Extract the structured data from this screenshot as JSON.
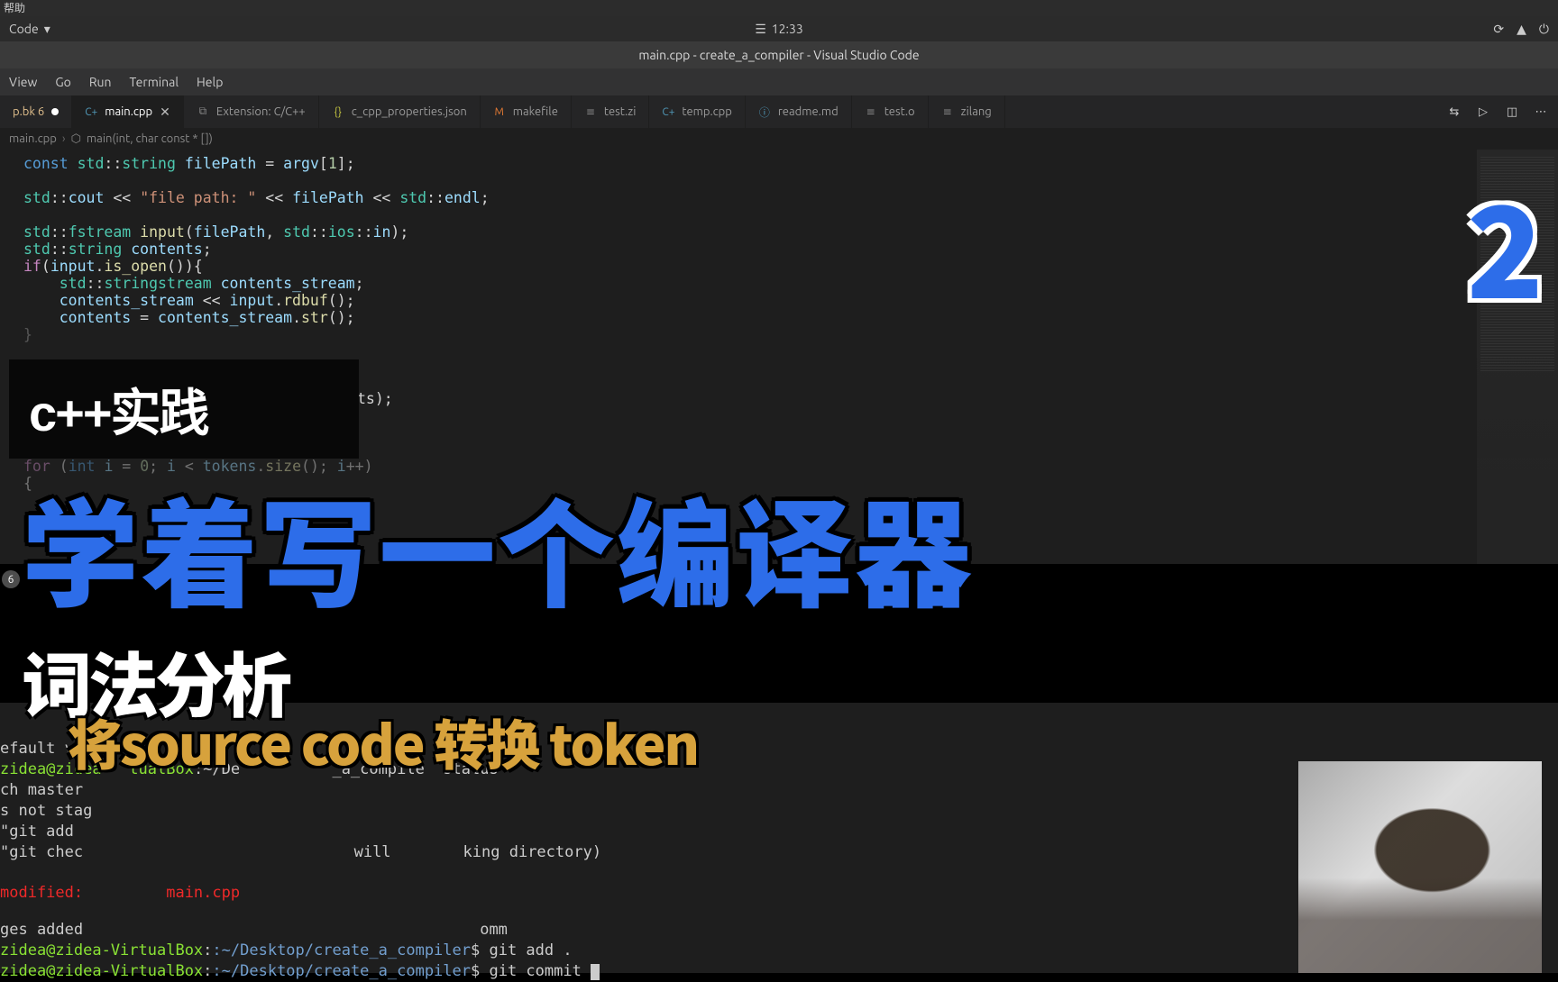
{
  "window_title_strip": "帮助",
  "appbar": {
    "left_label": "Code",
    "clock": "12:33"
  },
  "title_bar": "main.cpp - create_a_compiler - Visual Studio Code",
  "menubar": [
    "View",
    "Go",
    "Run",
    "Terminal",
    "Help"
  ],
  "tabs": {
    "t0": {
      "label": "p.bk 6"
    },
    "t1": {
      "label": "main.cpp"
    },
    "t2": {
      "label": "Extension: C/C++"
    },
    "t3": {
      "label": "c_cpp_properties.json"
    },
    "t4": {
      "label": "makefile"
    },
    "t5": {
      "label": "test.zi"
    },
    "t6": {
      "label": "temp.cpp"
    },
    "t7": {
      "label": "readme.md"
    },
    "t8": {
      "label": "test.o"
    },
    "t9": {
      "label": "zilang"
    }
  },
  "breadcrumbs": {
    "level0": "main.cpp",
    "level1": "main(int, char const * [])"
  },
  "code": {
    "partial": "ts);",
    "loop": "for (int i = 0; i < tokens.size(); i++)"
  },
  "problems_badge": "6",
  "terminal": {
    "l0": "efault valu",
    "l1_host": "zidea@zidea-  tualBox",
    "l1_path": ":~/De          _a_compile",
    "l1_cmd": "  status",
    "l2": "ch master",
    "l3": "s not stag",
    "l4": "\"git add",
    "l5a": "\"git chec",
    "l5b": "  will",
    "l5c": "king directory)",
    "l6": "modified:         main.cpp",
    "l7": "ges added                                           omm",
    "p2_host": "zidea@zidea-VirtualBox",
    "p2_path": ":~/Desktop/create_a_compiler",
    "p2_cmd": "$ git add .",
    "p3_host": "zidea@zidea-VirtualBox",
    "p3_path": ":~/Desktop/create_a_compiler",
    "p3_cmd": "$ git commit "
  },
  "captions": {
    "small": "c++实践",
    "title": "学着写一个编译器",
    "sub1": "词法分析",
    "sub2": "将source code 转换 token",
    "number": "2"
  }
}
